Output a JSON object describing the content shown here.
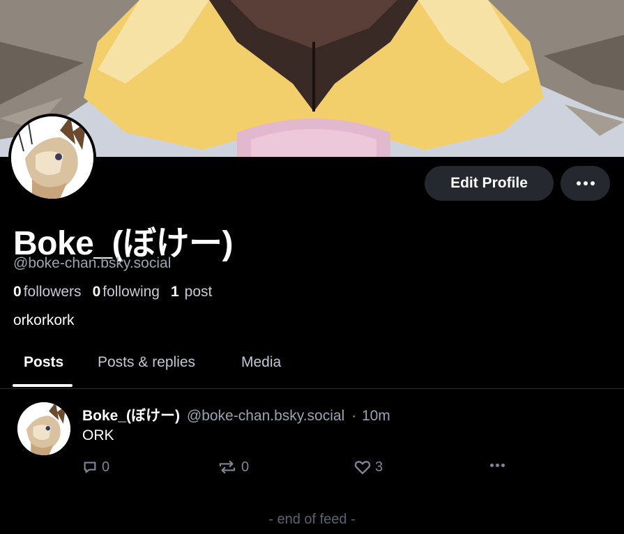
{
  "profile": {
    "display_name": "Boke_(ぼけー)",
    "handle": "@boke-chan.bsky.social",
    "followers_count": "0",
    "followers_label": "followers",
    "following_count": "0",
    "following_label": "following",
    "posts_count": "1",
    "posts_label": "post",
    "bio": "orkorkork"
  },
  "actions": {
    "edit_profile_label": "Edit Profile"
  },
  "tabs": [
    {
      "label": "Posts",
      "active": true
    },
    {
      "label": "Posts & replies",
      "active": false
    },
    {
      "label": "Media",
      "active": false
    }
  ],
  "feed": {
    "posts": [
      {
        "author_name": "Boke_(ぼけー)",
        "author_handle": "@boke-chan.bsky.social",
        "separator": "·",
        "time": "10m",
        "text": "ORK",
        "reply_count": "0",
        "repost_count": "0",
        "like_count": "3"
      }
    ],
    "end_label": "- end of feed -"
  },
  "colors": {
    "background": "#000000",
    "button_bg": "#25282f",
    "muted_text": "#9aa3b2",
    "action_icon": "#7d8596"
  },
  "icons": [
    "more-icon",
    "reply-icon",
    "repost-icon",
    "like-icon"
  ]
}
